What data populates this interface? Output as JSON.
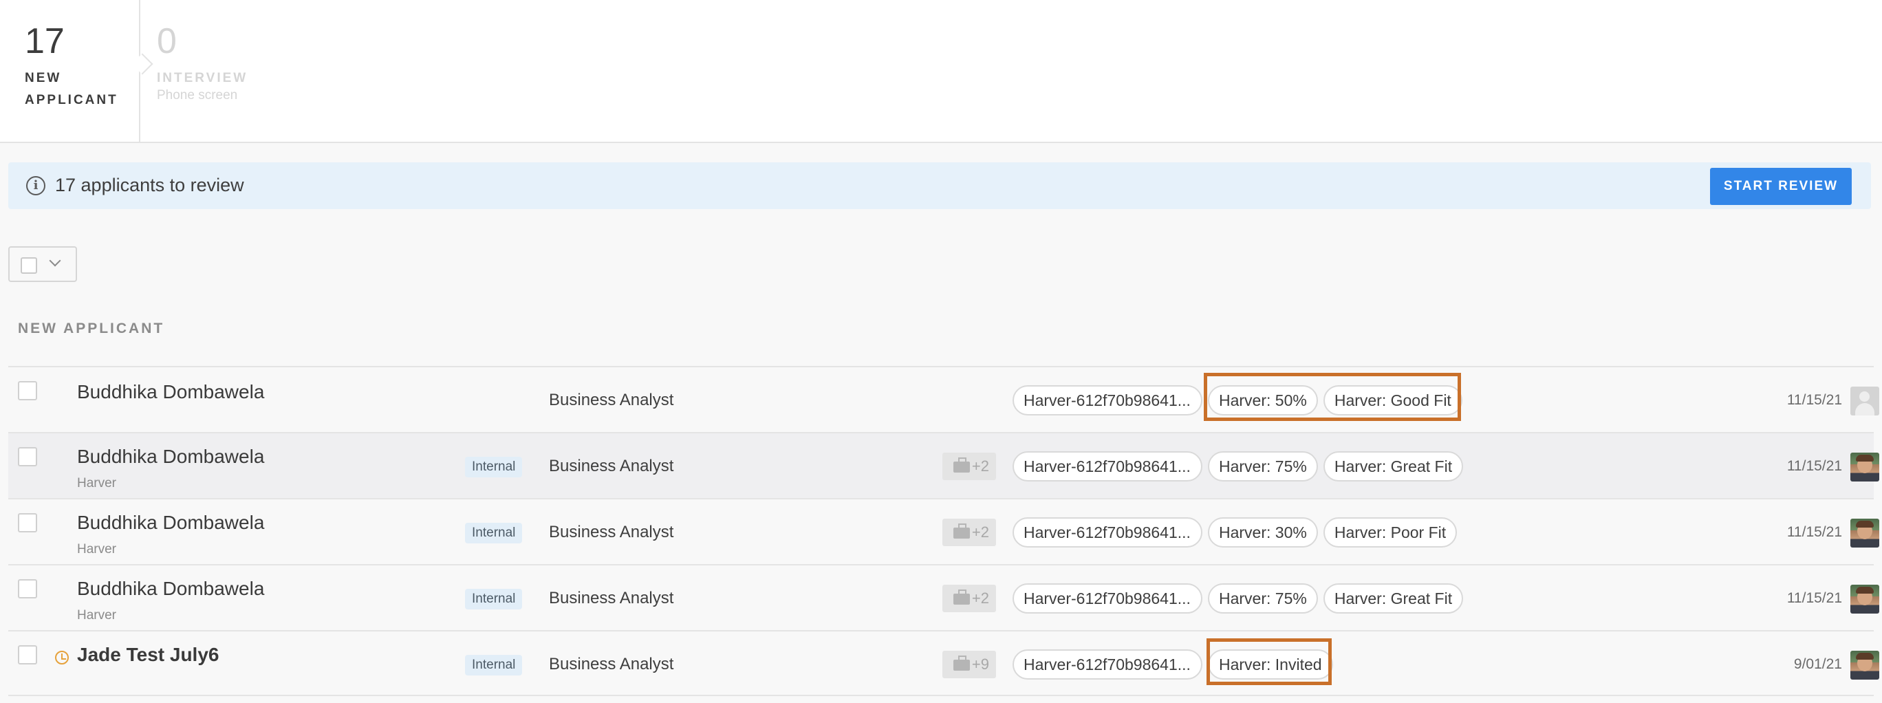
{
  "stages": [
    {
      "count": "17",
      "name_line1": "NEW",
      "name_line2": "APPLICANT",
      "sub": ""
    },
    {
      "count": "0",
      "name_line1": "INTERVIEW",
      "name_line2": "",
      "sub": "Phone screen"
    }
  ],
  "banner": {
    "icon": "info-icon",
    "text": "17 applicants to review",
    "button": "START REVIEW"
  },
  "list": {
    "section_label": "NEW APPLICANT"
  },
  "rows": [
    {
      "name": "Buddhika Dombawela",
      "source": "",
      "internal": "",
      "job": "Business Analyst",
      "more": "",
      "tags": [
        "Harver-612f70b98641...",
        "Harver: 50%",
        "Harver: Good Fit"
      ],
      "date": "11/15/21",
      "avatar": "blank"
    },
    {
      "name": "Buddhika Dombawela",
      "source": "Harver",
      "internal": "Internal",
      "job": "Business Analyst",
      "more": "+2",
      "tags": [
        "Harver-612f70b98641...",
        "Harver: 75%",
        "Harver: Great Fit"
      ],
      "date": "11/15/21",
      "avatar": "photo"
    },
    {
      "name": "Buddhika Dombawela",
      "source": "Harver",
      "internal": "Internal",
      "job": "Business Analyst",
      "more": "+2",
      "tags": [
        "Harver-612f70b98641...",
        "Harver: 30%",
        "Harver: Poor Fit"
      ],
      "date": "11/15/21",
      "avatar": "photo"
    },
    {
      "name": "Buddhika Dombawela",
      "source": "Harver",
      "internal": "Internal",
      "job": "Business Analyst",
      "more": "+2",
      "tags": [
        "Harver-612f70b98641...",
        "Harver: 75%",
        "Harver: Great Fit"
      ],
      "date": "11/15/21",
      "avatar": "photo"
    },
    {
      "name": "Jade Test July6",
      "source": "",
      "internal": "Internal",
      "job": "Business Analyst",
      "more": "+9",
      "tags": [
        "Harver-612f70b98641...",
        "Harver: Invited"
      ],
      "date": "9/01/21",
      "avatar": "photo"
    }
  ],
  "colors": {
    "accent": "#3286e8",
    "highlight_box": "#c9702a",
    "banner_bg": "#e6f1fa",
    "pending_clock": "#e6a23c"
  }
}
